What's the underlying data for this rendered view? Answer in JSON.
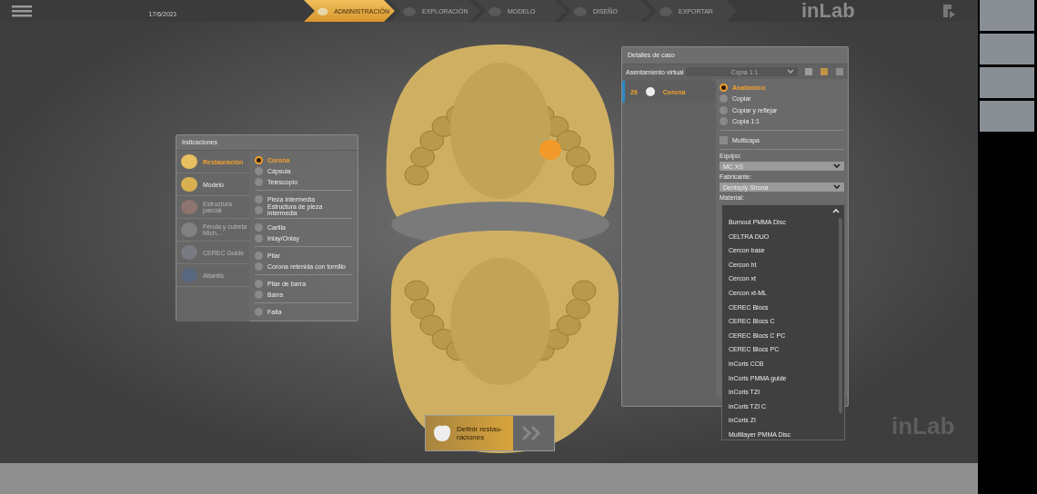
{
  "header": {
    "date": "17/6/2021",
    "workflow": [
      {
        "label": "ADMINISTRACIÓN",
        "selected": true
      },
      {
        "label": "EXPLORACIÓN",
        "selected": false
      },
      {
        "label": "MODELO",
        "selected": false
      },
      {
        "label": "DISEÑO",
        "selected": false
      },
      {
        "label": "EXPORTAR",
        "selected": false
      }
    ],
    "logo": "inLab"
  },
  "indications": {
    "title": "Indicaciones",
    "categories": [
      {
        "label": "Restauración",
        "selected": true,
        "disabled": false
      },
      {
        "label": "Modelo",
        "selected": false,
        "disabled": false
      },
      {
        "label": "Estructura parcial",
        "selected": false,
        "disabled": true
      },
      {
        "label": "Férula y cubeta Mich...",
        "selected": false,
        "disabled": true
      },
      {
        "label": "CEREC Guide",
        "selected": false,
        "disabled": true
      },
      {
        "label": "Atlantis",
        "selected": false,
        "disabled": true
      }
    ],
    "groups": [
      [
        {
          "label": "Corona",
          "selected": true
        },
        {
          "label": "Cápsula",
          "selected": false
        },
        {
          "label": "Telescopio",
          "selected": false
        }
      ],
      [
        {
          "label": "Pieza intermedia",
          "selected": false
        },
        {
          "label": "Estructura de pieza intermedia",
          "selected": false
        }
      ],
      [
        {
          "label": "Carilla",
          "selected": false
        },
        {
          "label": "Inlay/Onlay",
          "selected": false
        }
      ],
      [
        {
          "label": "Pilar",
          "selected": false
        },
        {
          "label": "Corona retenida con tornillo",
          "selected": false
        }
      ],
      [
        {
          "label": "Pilar de barra",
          "selected": false
        },
        {
          "label": "Barra",
          "selected": false
        }
      ],
      [
        {
          "label": "Falta",
          "selected": false
        }
      ]
    ]
  },
  "case_details": {
    "title": "Detalles de caso",
    "virtual_seating": {
      "label": "Asentamiento virtual",
      "value": "Copia 1:1",
      "disabled": true
    },
    "restorations": [
      {
        "tooth": "26",
        "label": "Corona",
        "selected": true
      }
    ],
    "design_modes": [
      {
        "label": "Anatómico",
        "selected": true
      },
      {
        "label": "Copiar",
        "selected": false
      },
      {
        "label": "Copiar y reflejar",
        "selected": false
      },
      {
        "label": "Copia 1:1",
        "selected": false
      }
    ],
    "multilayer": {
      "label": "Multicapa",
      "checked": false
    },
    "fields": [
      {
        "label": "Equipo:",
        "value": "MC XS"
      },
      {
        "label": "Fabricante:",
        "value": "Dentsply Sirona"
      },
      {
        "label": "Material:"
      }
    ],
    "material_options": [
      "Burnout PMMA Disc",
      "CELTRA DUO",
      "Cercon base",
      "Cercon ht",
      "Cercon xt",
      "Cercon xt-ML",
      "CEREC Blocs",
      "CEREC Blocs C",
      "CEREC Blocs C PC",
      "CEREC Blocs PC",
      "inCoris CCB",
      "inCoris PMMA guide",
      "inCoris TZI",
      "inCoris TZI C",
      "inCoris ZI",
      "Multilayer PMMA Disc"
    ]
  },
  "next_step": {
    "label": "Definir restau-\nraciones"
  },
  "corner_logo": "inLab"
}
